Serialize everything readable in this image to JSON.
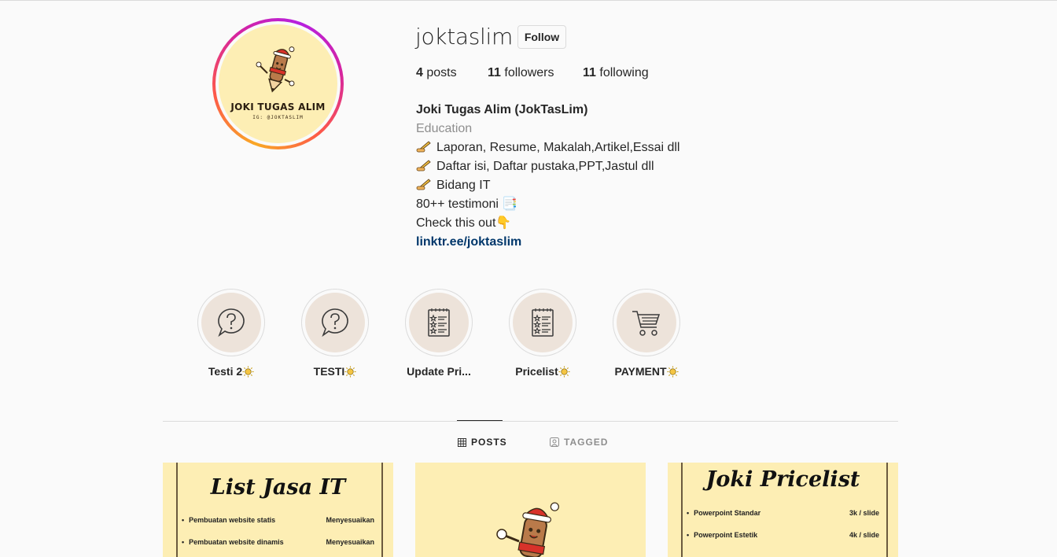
{
  "profile": {
    "avatar_title": "JOKI TUGAS ALIM",
    "avatar_sub": "IG: @JOKTASLIM",
    "username": "joktaslim",
    "follow_label": "Follow"
  },
  "stats": {
    "posts_count": "4",
    "posts_label": "posts",
    "followers_count": "11",
    "followers_label": "followers",
    "following_count": "11",
    "following_label": "following"
  },
  "bio": {
    "name": "Joki Tugas Alim (JokTasLim)",
    "category": "Education",
    "line1": "Laporan, Resume, Makalah,Artikel,Essai dll",
    "line2": "Daftar isi, Daftar pustaka,PPT,Jastul dll",
    "line3": "Bidang IT",
    "line4": "80++ testimoni 📑",
    "line5": "Check this out👇",
    "link": "linktr.ee/joktaslim"
  },
  "highlights": [
    {
      "label": "Testi 2",
      "icon": "question-bubble-icon"
    },
    {
      "label": "TESTI",
      "icon": "question-bubble-icon"
    },
    {
      "label": "Update Pri...",
      "icon": "checklist-icon"
    },
    {
      "label": "Pricelist",
      "icon": "checklist-icon"
    },
    {
      "label": "PAYMENT",
      "icon": "cart-icon"
    }
  ],
  "tabs": {
    "posts": "POSTS",
    "tagged": "TAGGED"
  },
  "posts": [
    {
      "title": "List Jasa IT",
      "rows": [
        {
          "item": "Pembuatan website statis",
          "price": "Menyesuaikan"
        },
        {
          "item": "Pembuatan website dinamis",
          "price": "Menyesuaikan"
        }
      ]
    },
    {
      "title": ""
    },
    {
      "title": "Joki Pricelist",
      "rows": [
        {
          "item": "Powerpoint Standar",
          "price": "3k / slide"
        },
        {
          "item": "Powerpoint Estetik",
          "price": "4k / slide"
        }
      ]
    }
  ],
  "colors": {
    "accent_link": "#00376b",
    "muted": "#8e8e8e",
    "highlight_bg": "#ede3da",
    "post_bg": "#fdeeb4"
  }
}
